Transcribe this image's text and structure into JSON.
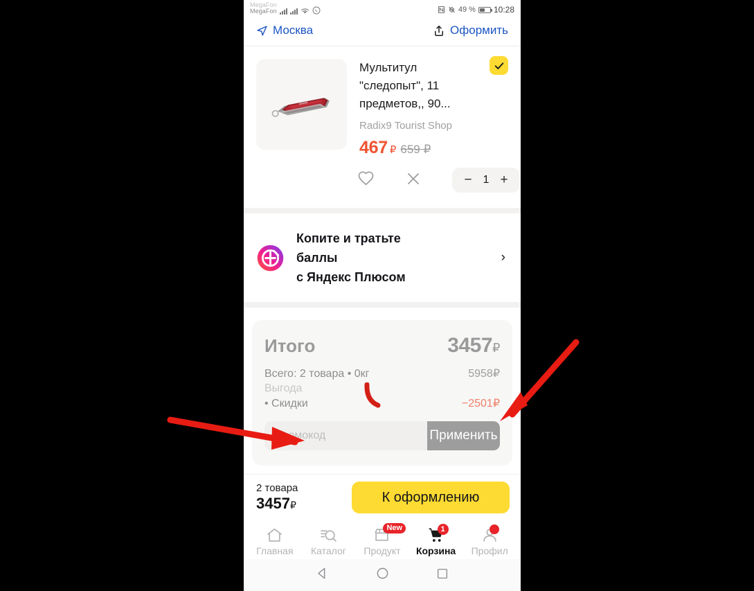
{
  "status_bar": {
    "carrier_top": "MegaFon",
    "carrier": "MegaFon",
    "battery_percent": "49 %",
    "clock": "10:28",
    "icons": [
      "signal-bars-icon",
      "signal-bars-icon",
      "wifi-icon",
      "whatsapp-icon",
      "nfc-icon",
      "vibrate-off-icon",
      "battery-icon"
    ]
  },
  "appbar": {
    "location": "Москва",
    "share": "Оформить"
  },
  "product": {
    "title": "Мультитул \"следопыт\", 11 предметов,, 90...",
    "shop": "Radix9 Tourist Shop",
    "price_new": "467",
    "price_new_currency": "₽",
    "price_old": "659 ₽",
    "quantity": "1",
    "minus": "−",
    "plus": "+",
    "selected": true
  },
  "plus_banner": {
    "line1": "Копите и тратьте",
    "line2": "баллы",
    "line3": "с Яндекс Плюсом",
    "chevron": "›"
  },
  "totals": {
    "label": "Итого",
    "amount": "3457",
    "currency": "₽",
    "items_label": "Всего: 2 товара • 0кг",
    "items_value": "5958₽",
    "benefit_label": "Выгода",
    "discount_label": "• Скидки",
    "discount_value": "−2501₽",
    "promo_placeholder": "Промокод",
    "promo_value": "",
    "promo_button": "Применить"
  },
  "checkout": {
    "count": "2 товара",
    "sum": "3457",
    "currency": "₽",
    "button": "К оформлению"
  },
  "tabbar": [
    {
      "label": "Главная",
      "icon": "home-icon",
      "active": false,
      "badge": ""
    },
    {
      "label": "Каталог",
      "icon": "catalog-search-icon",
      "active": false,
      "badge": ""
    },
    {
      "label": "Продукт",
      "icon": "store-icon",
      "active": false,
      "badge": "New"
    },
    {
      "label": "Корзина",
      "icon": "cart-icon",
      "active": true,
      "badge": "1"
    },
    {
      "label": "Профил",
      "icon": "profile-icon",
      "active": false,
      "badge": ""
    }
  ],
  "android_nav": [
    "back-triangle-icon",
    "home-circle-icon",
    "recents-square-icon"
  ],
  "colors": {
    "accent_yellow": "#fddb32",
    "price_red": "#ef5432",
    "link_blue": "#1b55c4",
    "badge_red": "#e8242a",
    "annotation_red": "#e81c13"
  }
}
